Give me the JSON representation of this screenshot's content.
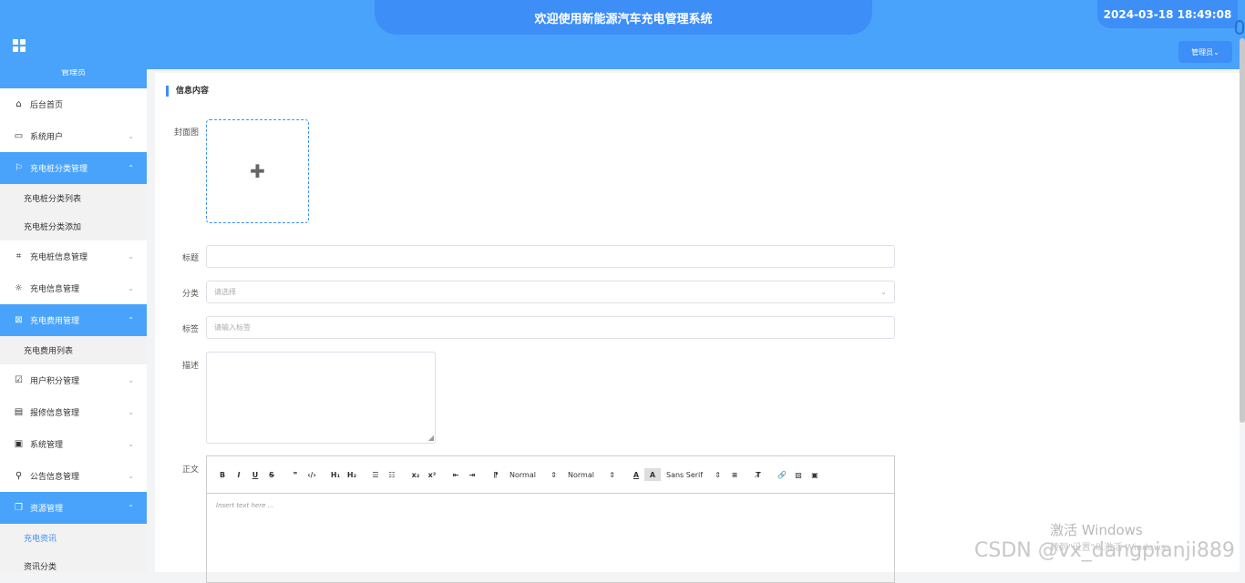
{
  "header": {
    "title": "欢迎使用新能源汽车充电管理系统",
    "datetime": "2024-03-18 18:49:08",
    "admin_label": "管理员",
    "admin_chevron": "⌄"
  },
  "sidebar": {
    "top_label": "管理员",
    "items": [
      {
        "label": "后台首页",
        "icon": "⌂",
        "icon_name": "home-icon",
        "chevron": ""
      },
      {
        "label": "系统用户",
        "icon": "▭",
        "icon_name": "monitor-icon",
        "chevron": "⌄"
      },
      {
        "label": "充电桩分类管理",
        "icon": "⚐",
        "icon_name": "bookmark-icon",
        "chevron": "⌃"
      },
      {
        "label": "充电桩分类列表"
      },
      {
        "label": "充电桩分类添加"
      },
      {
        "label": "充电桩信息管理",
        "icon": "⌗",
        "icon_name": "tag-icon",
        "chevron": "⌄"
      },
      {
        "label": "充电信息管理",
        "icon": "☼",
        "icon_name": "sun-icon",
        "chevron": "⌄"
      },
      {
        "label": "充电费用管理",
        "icon": "⊠",
        "icon_name": "inbox-icon",
        "chevron": "⌃"
      },
      {
        "label": "充电费用列表"
      },
      {
        "label": "用户积分管理",
        "icon": "☑",
        "icon_name": "clipboard-icon",
        "chevron": "⌄"
      },
      {
        "label": "报修信息管理",
        "icon": "▤",
        "icon_name": "message-icon",
        "chevron": "⌄"
      },
      {
        "label": "系统管理",
        "icon": "▣",
        "icon_name": "archive-icon",
        "chevron": "⌄"
      },
      {
        "label": "公告信息管理",
        "icon": "⚲",
        "icon_name": "paperclip-icon",
        "chevron": "⌄"
      },
      {
        "label": "资源管理",
        "icon": "❐",
        "icon_name": "copy-icon",
        "chevron": "⌃"
      },
      {
        "label": "充电资讯"
      },
      {
        "label": "资讯分类"
      }
    ]
  },
  "form": {
    "section_title": "信息内容",
    "cover_label": "封面图",
    "title_label": "标题",
    "category_label": "分类",
    "category_placeholder": "请选择",
    "tags_label": "标签",
    "tags_placeholder": "请输入标签",
    "desc_label": "描述",
    "body_label": "正文",
    "editor_placeholder": "Insert text here ...",
    "toolbar": {
      "bold": "B",
      "italic": "I",
      "underline": "U",
      "strike": "S",
      "quote": "❞",
      "code": "‹/›",
      "h1": "H₁",
      "h2": "H₂",
      "ol": "☰",
      "ul": "☷",
      "sub": "x₂",
      "sup": "x²",
      "outdent": "⇤",
      "indent": "⇥",
      "direction": "⁋",
      "size": "Normal",
      "header": "Normal",
      "color": "A",
      "bg": "A",
      "font": "Sans Serif",
      "align": "≡",
      "clean": "T̸",
      "link": "🔗",
      "image": "▨",
      "video": "▣"
    }
  },
  "watermarks": {
    "windows": "激活 Windows",
    "windows_sub": "转到\"设置\"以激活 Windows。",
    "csdn": "CSDN @vx_dangpianji889"
  },
  "colors": {
    "primary": "#4aa3fb",
    "accent": "#3d8ef7"
  }
}
